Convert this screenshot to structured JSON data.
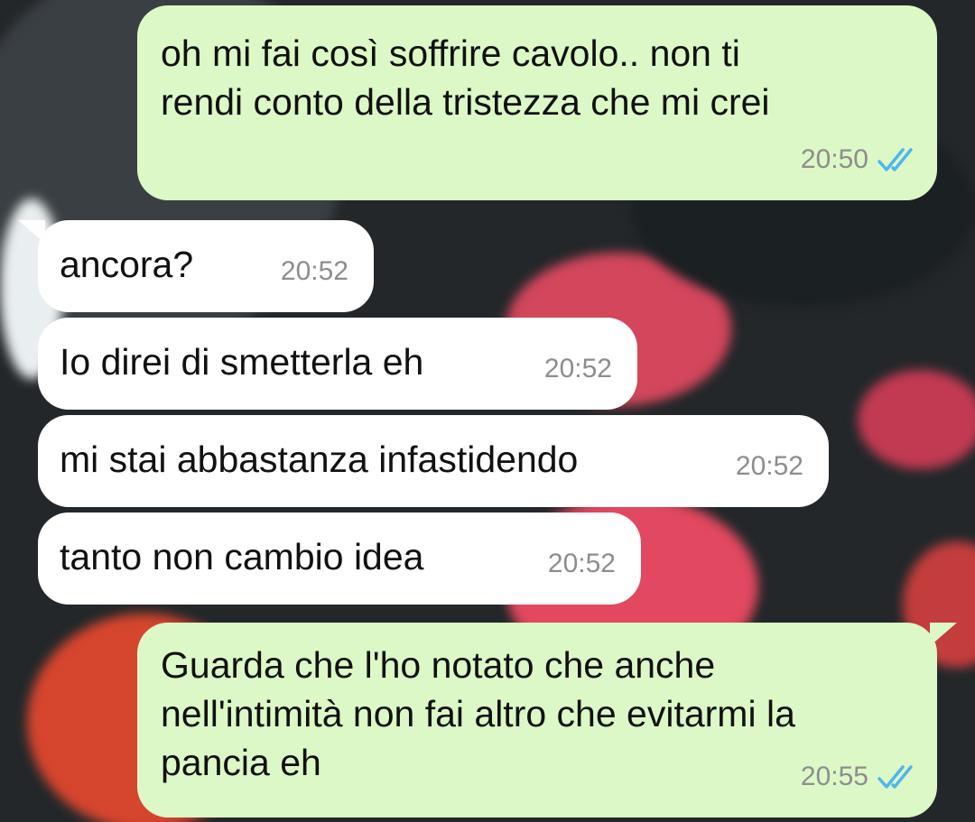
{
  "colors": {
    "outgoing_bubble": "#dcf8c6",
    "incoming_bubble": "#ffffff",
    "read_ticks": "#4fb6ec",
    "timestamp": "#8d8d8d"
  },
  "messages": [
    {
      "direction": "outgoing",
      "text": "oh mi fai così soffrire cavolo.. non ti\nrendi conto della tristezza che mi crei",
      "time": "20:50",
      "status_icon": "double-check-read-icon"
    },
    {
      "direction": "incoming",
      "text": "ancora?",
      "time": "20:52"
    },
    {
      "direction": "incoming",
      "text": "Io direi di smetterla eh",
      "time": "20:52"
    },
    {
      "direction": "incoming",
      "text": "mi stai abbastanza infastidendo",
      "time": "20:52"
    },
    {
      "direction": "incoming",
      "text": "tanto non cambio idea",
      "time": "20:52"
    },
    {
      "direction": "outgoing",
      "text": "Guarda che l'ho notato che anche\nnell'intimità non fai altro che evitarmi la\npancia eh",
      "time": "20:55",
      "status_icon": "double-check-read-icon"
    }
  ]
}
